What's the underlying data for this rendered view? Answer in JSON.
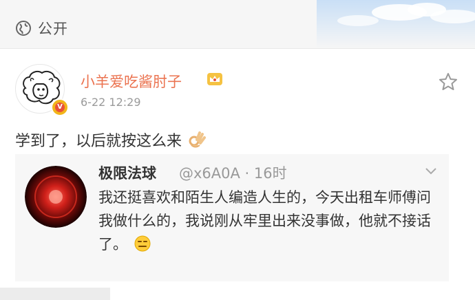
{
  "header": {
    "visibility_label": "公开",
    "icon": "globe-icon"
  },
  "post": {
    "author": "小羊爱吃酱肘子",
    "time": "6-22 12:29",
    "text": "学到了，以后就按这么来",
    "verified_badge": "V",
    "badges": [
      "crown-icon",
      "verified-icon"
    ],
    "actions": [
      "star-icon"
    ],
    "emoji": "ok-hand-icon"
  },
  "quoted": {
    "author": "极限法球",
    "handle": "@x6A0A · 16时",
    "text": "我还挺喜欢和陌生人编造人生的，今天出租车师傅问我做什么的，我说刚从牢里出来没事做，他就不接话了。",
    "emoji": "expressionless-face-icon",
    "menu_icon": "chevron-down-icon"
  },
  "colors": {
    "accent": "#eb7350",
    "text": "#333333",
    "secondary": "#9a9a9a",
    "quote_bg": "#f7f7f7"
  }
}
